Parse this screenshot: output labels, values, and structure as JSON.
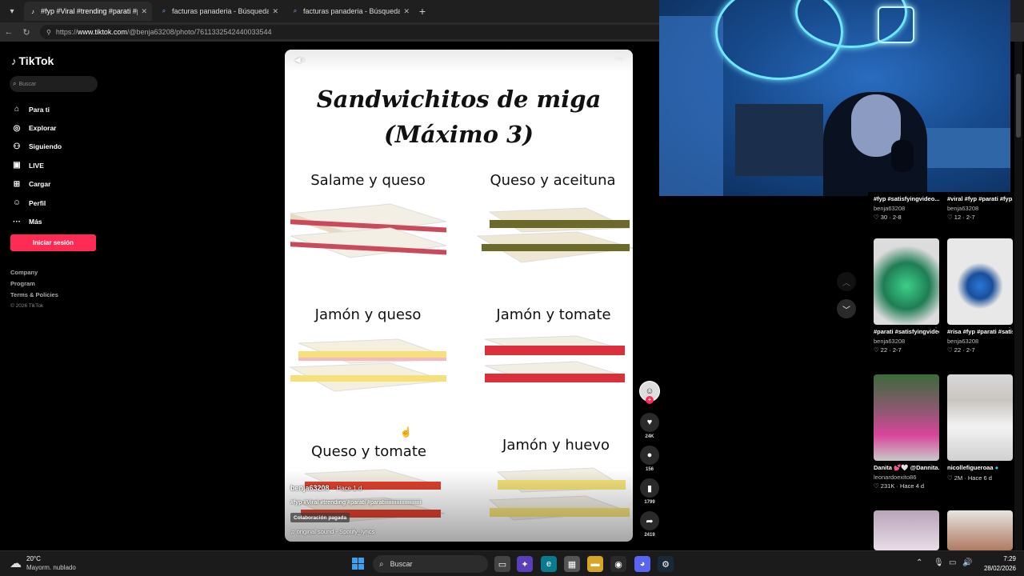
{
  "browser": {
    "tabs": [
      {
        "title": "#fyp #Viral #trending #parati #pa",
        "active": true
      },
      {
        "title": "facturas panaderia - Búsqueda",
        "active": false
      },
      {
        "title": "facturas panaderia - Búsqueda Ima",
        "active": false
      }
    ],
    "url_prefix": "https://",
    "url_host": "www.tiktok.com",
    "url_path": "/@benja63208/photo/7611332542440033544"
  },
  "sidebar": {
    "logo": "TikTok",
    "search_placeholder": "Buscar",
    "nav": [
      {
        "label": "Para ti",
        "icon": "home-icon"
      },
      {
        "label": "Explorar",
        "icon": "compass-icon"
      },
      {
        "label": "Siguiendo",
        "icon": "following-icon"
      },
      {
        "label": "LIVE",
        "icon": "live-icon"
      },
      {
        "label": "Cargar",
        "icon": "upload-icon"
      },
      {
        "label": "Perfil",
        "icon": "profile-icon"
      },
      {
        "label": "Más",
        "icon": "more-icon"
      }
    ],
    "login": "Iniciar sesión",
    "footer": [
      "Company",
      "Program",
      "Terms & Policies"
    ],
    "copyright": "© 2026 TikTok"
  },
  "post": {
    "title_line1": "Sandwichitos de miga",
    "title_line2": "(Máximo 3)",
    "items": [
      "Salame y queso",
      "Queso y aceituna",
      "Jamón y queso",
      "Jamón y tomate",
      "Queso y tomate",
      "Jamón y huevo"
    ],
    "username": "benja63208",
    "time": "· Hace 1 d",
    "tags": "#fyp #Viral #trending #parati #paratiiiiiiiiiiiiiiiiiiiiiiii",
    "paid": "Colaboración pagada",
    "sound": "original sound - Spotify_lyrics"
  },
  "actions": {
    "likes": "24K",
    "comments": "156",
    "saves": "1799",
    "shares": "2419"
  },
  "feed": [
    {
      "title": "#fyp #satisfyingvideo...",
      "user": "benja63208",
      "stats": "♡ 30 · 2-8"
    },
    {
      "title": "#viral #fyp #parati #fyp...",
      "user": "benja63208",
      "stats": "♡ 12 · 2-7"
    },
    {
      "title": "#parati #satisfyingvideo...",
      "user": "benja63208",
      "stats": "♡ 22 · 2-7"
    },
    {
      "title": "#risa #fyp #parati #satisfyingvideo...",
      "user": "benja63208",
      "stats": "♡ 22 · 2-7"
    },
    {
      "title": "Danita 💕🤍 @Dannita...",
      "user": "leonardoexito86",
      "stats": "♡ 231K · Hace 4 d"
    },
    {
      "title": "nicollefigueroaa",
      "user": "",
      "stats": "♡ 2M · Hace 6 d"
    }
  ],
  "taskbar": {
    "temp": "20°C",
    "weather": "Mayorm. nublado",
    "search": "Buscar",
    "time": "7:29",
    "date": "28/02/2026"
  },
  "colors": {
    "accent": "#fe2c55",
    "neon": "#6fe8ff"
  }
}
